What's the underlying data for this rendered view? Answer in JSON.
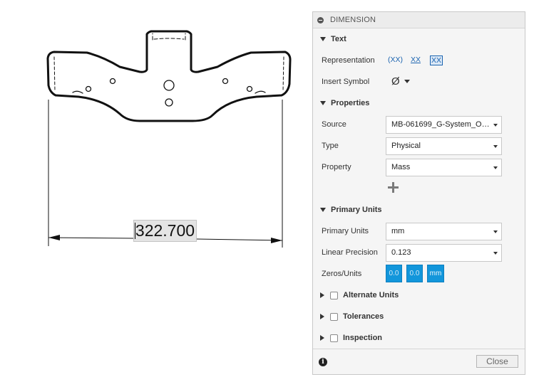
{
  "drawing": {
    "dimension_value": "322.700"
  },
  "panel": {
    "title": "DIMENSION",
    "text_section": {
      "label": "Text",
      "representation_label": "Representation",
      "representation_options": [
        "(XX)",
        "XX",
        "XX"
      ],
      "insert_symbol_label": "Insert Symbol",
      "symbol_glyph": "Ø"
    },
    "properties_section": {
      "label": "Properties",
      "source_label": "Source",
      "source_value": "MB-061699_G-System_OK ...",
      "type_label": "Type",
      "type_value": "Physical",
      "property_label": "Property",
      "property_value": "Mass"
    },
    "primary_units_section": {
      "label": "Primary Units",
      "primary_units_label": "Primary Units",
      "primary_units_value": "mm",
      "linear_precision_label": "Linear Precision",
      "linear_precision_value": "0.123",
      "zeros_units_label": "Zeros/Units",
      "zeros_buttons": [
        "0.0",
        "0.0",
        "mm"
      ]
    },
    "alternate_units_label": "Alternate Units",
    "tolerances_label": "Tolerances",
    "inspection_label": "Inspection",
    "footer": {
      "info_glyph": "i",
      "close_label": "Close"
    },
    "colors": {
      "accent": "#1296db",
      "link": "#1a63b0"
    }
  }
}
